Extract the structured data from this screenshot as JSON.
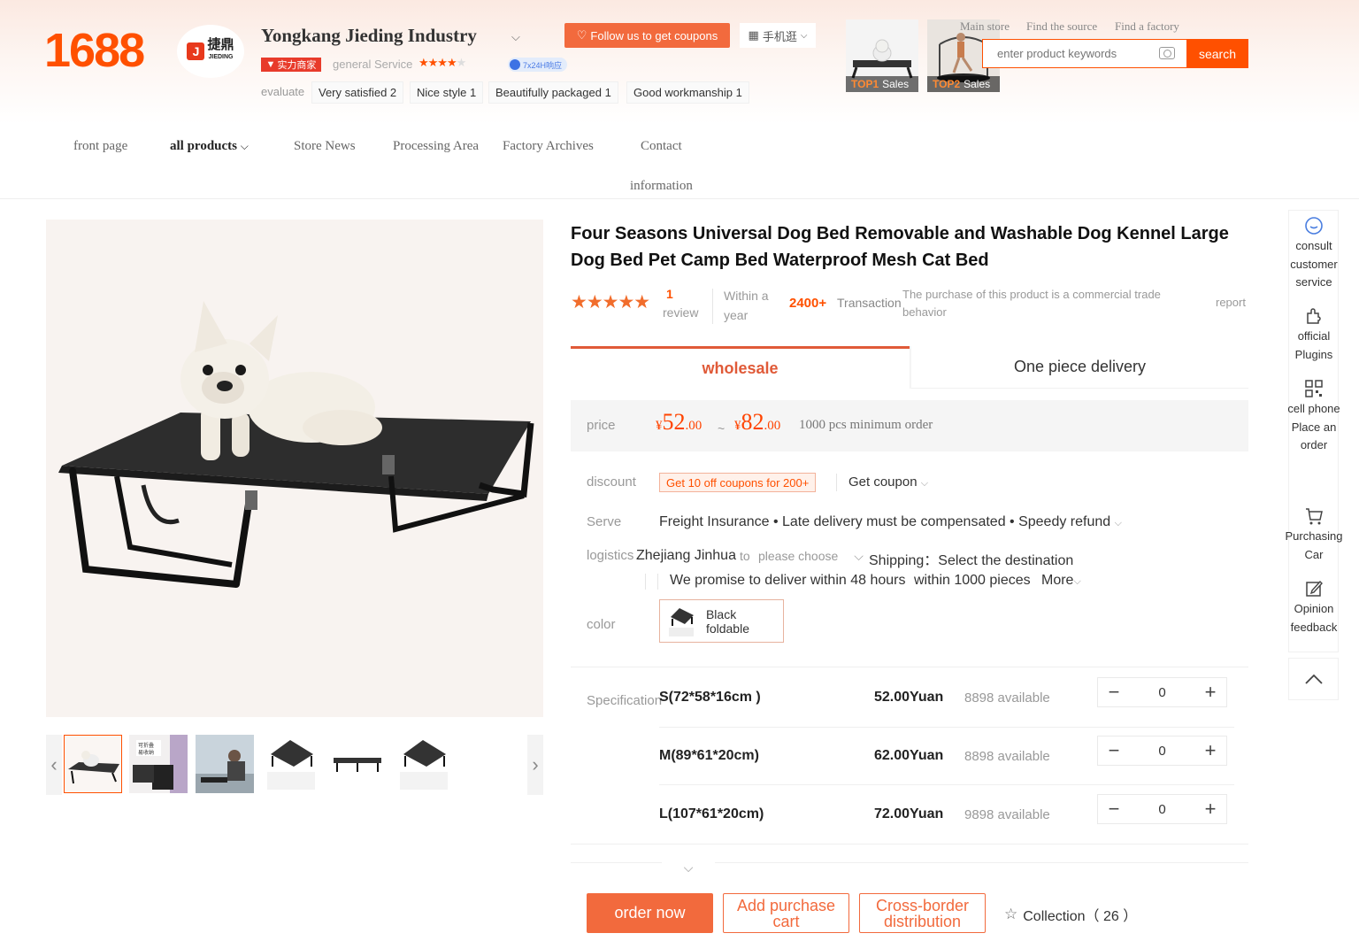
{
  "header": {
    "logo": "1688",
    "shop_logo_cn": "捷鼎",
    "shop_logo_en": "JIEDING",
    "shop_name": "Yongkang Jieding Industry",
    "follow_label": "Follow us to get coupons",
    "mobile_label": "手机逛",
    "strength_badge": "实力商家",
    "service_label": "general Service",
    "service_rating": 4,
    "badge_24h": "7x24H响应",
    "evaluate_label": "evaluate",
    "eval_tags": [
      "Very satisfied 2",
      "Nice style 1",
      "Beautifully packaged 1",
      "Good workmanship 1"
    ],
    "top_sales": [
      {
        "rank": "TOP1",
        "label": "Sales"
      },
      {
        "rank": "TOP2",
        "label": "Sales"
      }
    ],
    "top_links": [
      "Main store",
      "Find the source",
      "Find a factory"
    ],
    "search_placeholder": "enter product keywords",
    "search_button": "search"
  },
  "nav": {
    "items": [
      "front page",
      "all products",
      "Store News",
      "Processing Area",
      "Factory Archives",
      "Contact",
      "information"
    ]
  },
  "product": {
    "title": "Four Seasons Universal Dog Bed Removable and Washable Dog Kennel Large Dog Bed Pet Camp Bed Waterproof Mesh Cat Bed",
    "rating_stars": 5,
    "review_count": "1",
    "review_label": "review",
    "within_year": "Within a year",
    "transactions_num": "2400+",
    "transactions_label": "Transaction",
    "commercial_note": "The purchase of this product is a commercial trade behavior",
    "report": "report",
    "tabs": [
      "wholesale",
      "One piece delivery"
    ],
    "price_label": "price",
    "price_low": {
      "currency": "¥",
      "int": "52",
      "dec": ".00"
    },
    "price_high": {
      "currency": "¥",
      "int": "82",
      "dec": ".00"
    },
    "price_sep": "~",
    "moq": "1000 pcs minimum order",
    "discount_label": "discount",
    "coupon_tag": "Get 10 off coupons for 200+",
    "get_coupon": "Get coupon",
    "serve_label": "Serve",
    "serve_text": "Freight Insurance • Late delivery must be compensated • Speedy refund",
    "logistics_label": "logistics",
    "logistics_from": "Zhejiang Jinhua",
    "logistics_to": "to",
    "logistics_choose": "please choose",
    "shipping_text": "Shipping：Select the destination",
    "promise_text": "We promise to deliver within 48 hours",
    "promise_qty": "within 1000 pieces",
    "more": "More",
    "color_label": "color",
    "color_option": "Black foldable",
    "spec_label": "Specification",
    "specs": [
      {
        "name": "S(72*58*16cm )",
        "price": "52.00Yuan",
        "available": "8898 available",
        "qty": "0"
      },
      {
        "name": "M(89*61*20cm)",
        "price": "62.00Yuan",
        "available": "8898 available",
        "qty": "0"
      },
      {
        "name": "L(107*61*20cm)",
        "price": "72.00Yuan",
        "available": "9898 available",
        "qty": "0"
      }
    ],
    "actions": {
      "order_now": "order now",
      "add_cart": "Add purchase cart",
      "cross_border": "Cross-border distribution",
      "collection": "Collection（ 26 ）"
    }
  },
  "rail": {
    "items": [
      "consult customer service",
      "official Plugins",
      "cell phone Place an order",
      "Purchasing Car",
      "Opinion feedback"
    ]
  },
  "colors": {
    "brand": "#ff5000",
    "accent": "#f26a3d",
    "price": "#ff4400"
  }
}
